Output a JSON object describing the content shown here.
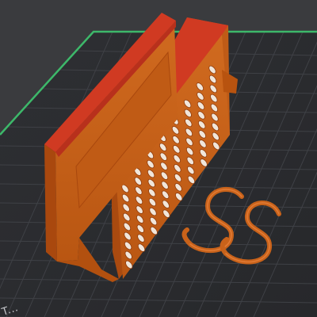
{
  "viewport": {
    "background_color": "#3a3b3e",
    "bed_color": "#2b2c2f",
    "grid_color": "#3f4146",
    "bed_edge_color": "#3db86a",
    "bed_label": "T..."
  },
  "objects": {
    "caddy": {
      "name": "slotted-caddy",
      "body_color": "#c8621a",
      "top_color": "#d03a22"
    },
    "hooks": {
      "name": "s-hooks",
      "count": 2,
      "color": "#c8621a"
    }
  }
}
